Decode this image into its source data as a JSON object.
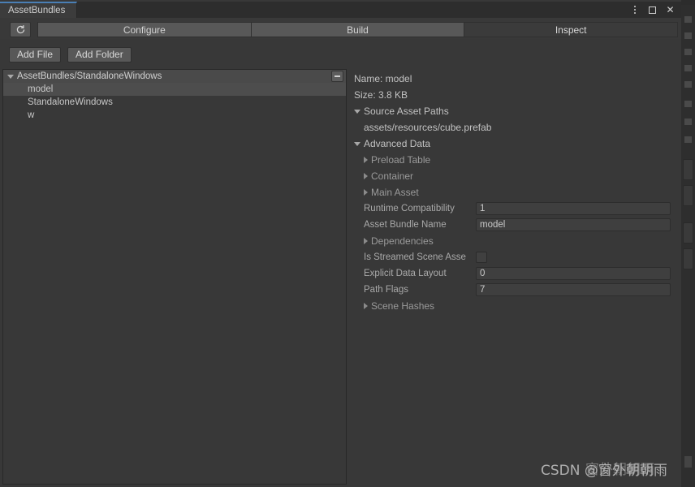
{
  "window": {
    "tab_label": "AssetBundles",
    "accent_color": "#4a7fb5",
    "controls": {
      "menu_icon": "kebab-menu-icon",
      "maximize_icon": "maximize-icon",
      "close_icon": "close-icon",
      "close_glyph": "✕"
    }
  },
  "toolbar": {
    "refresh_icon": "refresh-icon",
    "modes": [
      {
        "label": "Configure",
        "active": false
      },
      {
        "label": "Build",
        "active": false
      },
      {
        "label": "Inspect",
        "active": true
      }
    ]
  },
  "actions": {
    "add_file_label": "Add File",
    "add_folder_label": "Add Folder"
  },
  "tree": {
    "header": {
      "label": "AssetBundles/StandaloneWindows",
      "expanded": true,
      "remove_button": "remove-path-button"
    },
    "rows": [
      {
        "label": "model",
        "selected": true
      },
      {
        "label": "StandaloneWindows",
        "selected": false
      },
      {
        "label": "w",
        "selected": false
      }
    ]
  },
  "inspector": {
    "name_line": "Name: model",
    "size_line": "Size: 3.8 KB",
    "source_asset_paths": {
      "label": "Source Asset Paths",
      "expanded": true,
      "items": [
        "assets/resources/cube.prefab"
      ]
    },
    "advanced_data": {
      "label": "Advanced Data",
      "expanded": true,
      "foldouts_a": [
        {
          "label": "Preload Table",
          "expanded": false
        },
        {
          "label": "Container",
          "expanded": false
        },
        {
          "label": "Main Asset",
          "expanded": false
        }
      ],
      "fields_a": [
        {
          "label": "Runtime Compatibility",
          "value": "1",
          "type": "text"
        },
        {
          "label": "Asset Bundle Name",
          "value": "model",
          "type": "text"
        }
      ],
      "foldouts_b": [
        {
          "label": "Dependencies",
          "expanded": false
        }
      ],
      "fields_b": [
        {
          "label": "Is Streamed Scene Asse",
          "value": "",
          "type": "checkbox",
          "checked": false
        },
        {
          "label": "Explicit Data Layout",
          "value": "0",
          "type": "text"
        },
        {
          "label": "Path Flags",
          "value": "7",
          "type": "text"
        }
      ],
      "foldouts_c": [
        {
          "label": "Scene Hashes",
          "expanded": false
        }
      ]
    }
  },
  "watermark": {
    "text": "CSDN @窗外朝朝雨",
    "overlay_text": "窗外朝朝雨"
  }
}
